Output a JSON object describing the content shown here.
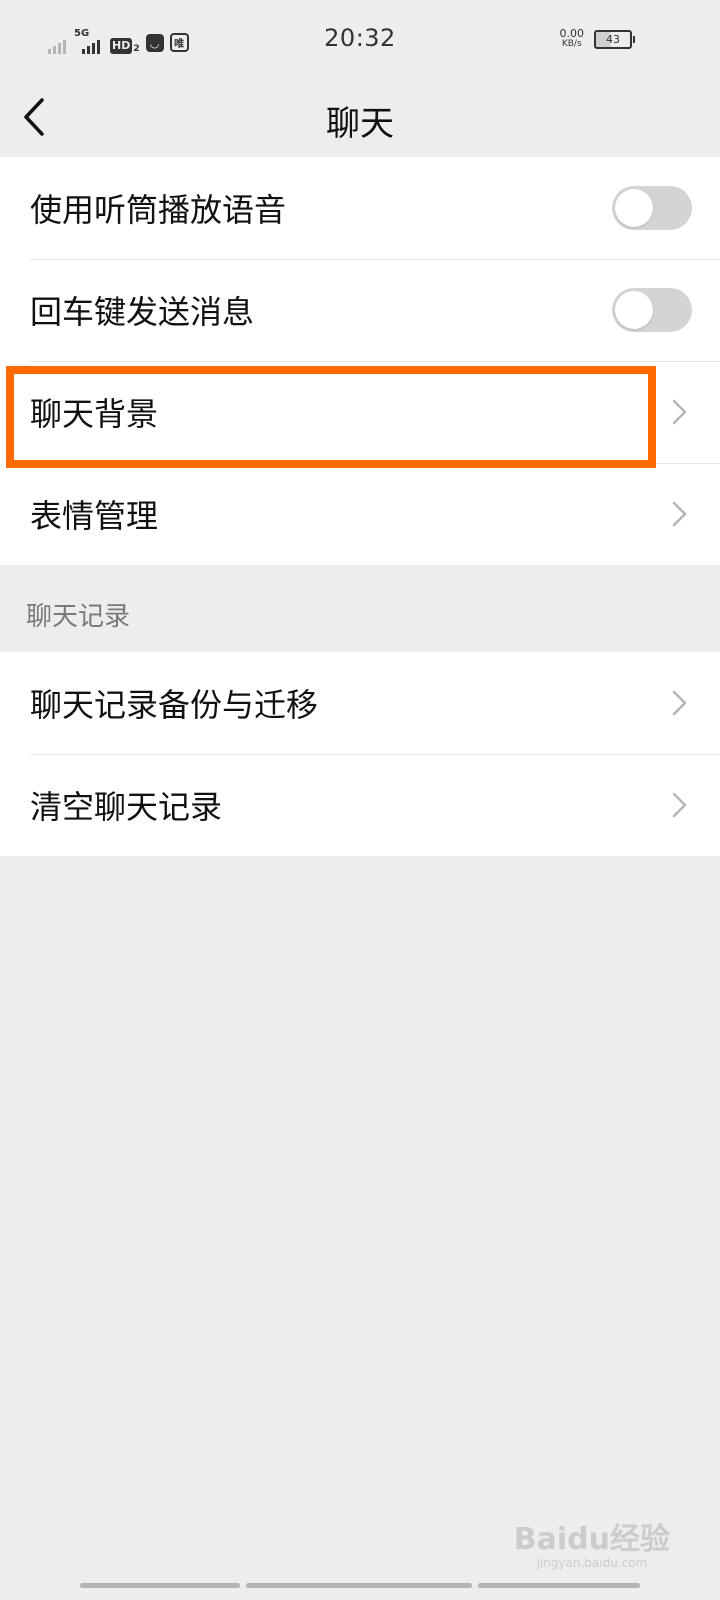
{
  "status_bar": {
    "time": "20:32",
    "network_type": "5G",
    "hd_label": "HD",
    "hd_sub": "2",
    "app_icon_2": "唯",
    "net_speed_value": "0.00",
    "net_speed_unit": "KB/s",
    "battery_level": "43"
  },
  "nav": {
    "title": "聊天",
    "back_icon": "chevron-left-icon"
  },
  "settings": {
    "group1": [
      {
        "label": "使用听筒播放语音",
        "control": "toggle",
        "on": false
      },
      {
        "label": "回车键发送消息",
        "control": "toggle",
        "on": false
      },
      {
        "label": "聊天背景",
        "control": "chevron",
        "highlighted": true
      },
      {
        "label": "表情管理",
        "control": "chevron"
      }
    ],
    "section_header": "聊天记录",
    "group2": [
      {
        "label": "聊天记录备份与迁移",
        "control": "chevron"
      },
      {
        "label": "清空聊天记录",
        "control": "chevron"
      }
    ]
  },
  "watermark": {
    "brand": "Baidu经验",
    "url": "jingyan.baidu.com"
  },
  "colors": {
    "background": "#ededed",
    "card": "#ffffff",
    "highlight": "#ff6a00",
    "toggle_off": "#d4d4d4",
    "section_text": "#7a7a7a"
  }
}
